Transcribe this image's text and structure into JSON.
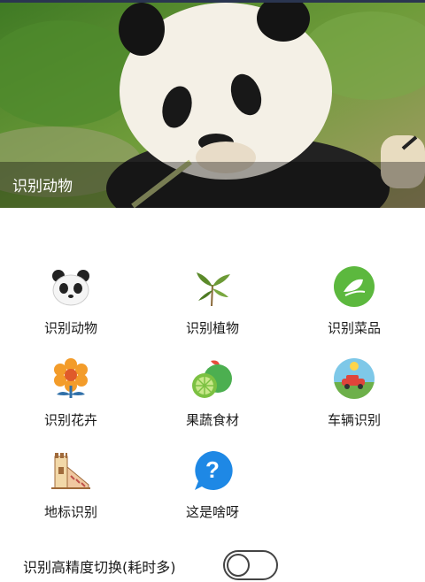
{
  "banner": {
    "title": "识别动物"
  },
  "features": [
    {
      "label": "识别动物",
      "icon": "panda-icon"
    },
    {
      "label": "识别植物",
      "icon": "plant-icon"
    },
    {
      "label": "识别菜品",
      "icon": "dish-leaf-icon"
    },
    {
      "label": "识别花卉",
      "icon": "flower-icon"
    },
    {
      "label": "果蔬食材",
      "icon": "lime-icon"
    },
    {
      "label": "车辆识别",
      "icon": "car-icon"
    },
    {
      "label": "地标识别",
      "icon": "landmark-icon"
    },
    {
      "label": "这是啥呀",
      "icon": "question-icon"
    }
  ],
  "settings": {
    "hd_toggle_label": "识别高精度切换(耗时多)",
    "hd_toggle_on": false
  },
  "colors": {
    "green": "#5cb83e",
    "blue": "#1e88e5",
    "caption_overlay": "rgba(0,0,0,0.35)"
  }
}
